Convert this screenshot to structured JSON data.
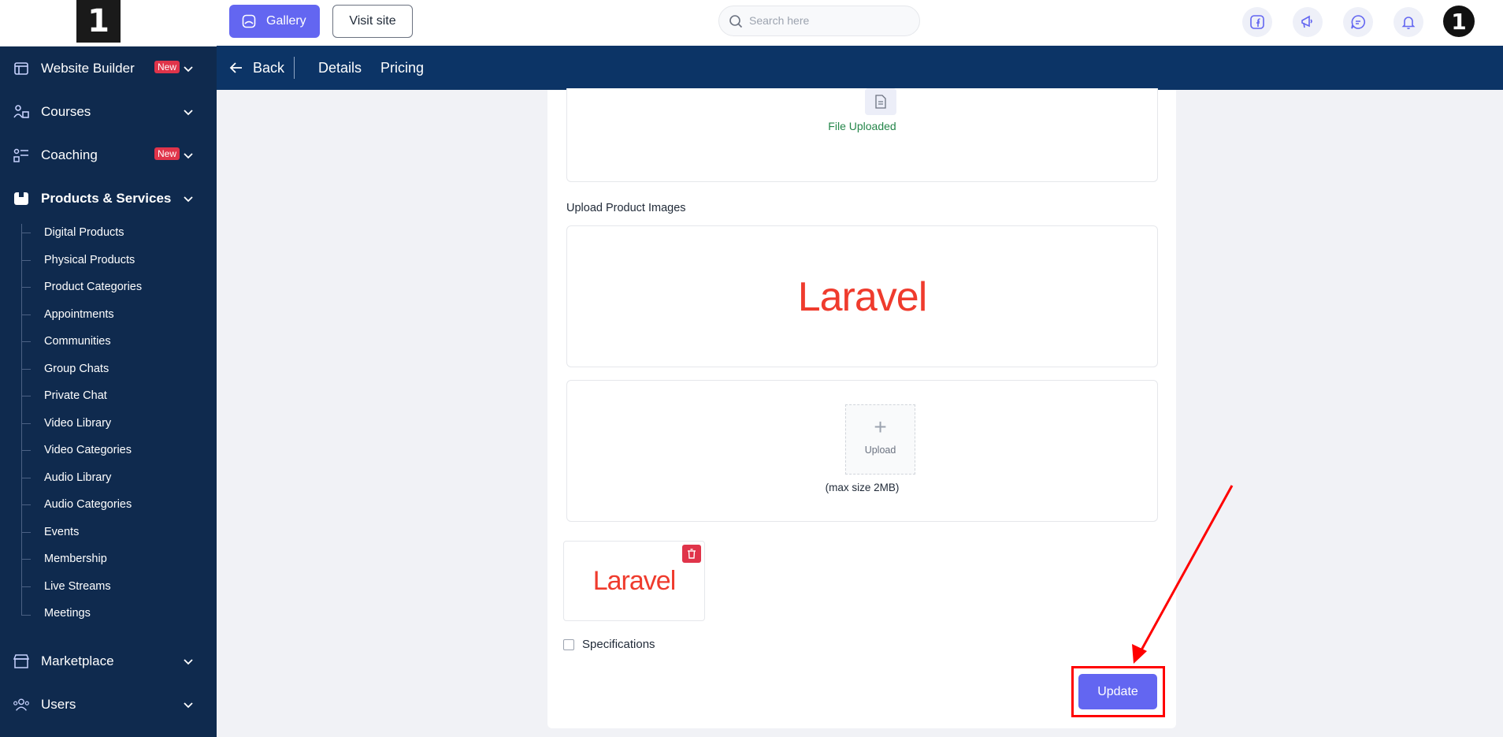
{
  "topbar": {
    "gallery_label": "Gallery",
    "visit_label": "Visit site",
    "search_placeholder": "Search here"
  },
  "sidebar": {
    "logo_text": "1",
    "items": [
      {
        "label": "Website Builder",
        "badge": "New"
      },
      {
        "label": "Courses"
      },
      {
        "label": "Coaching",
        "badge": "New"
      },
      {
        "label": "Products & Services"
      },
      {
        "label": "Marketplace"
      },
      {
        "label": "Users"
      }
    ],
    "sub_items": [
      "Digital Products",
      "Physical Products",
      "Product Categories",
      "Appointments",
      "Communities",
      "Group Chats",
      "Private Chat",
      "Video Library",
      "Video Categories",
      "Audio Library",
      "Audio Categories",
      "Events",
      "Membership",
      "Live Streams",
      "Meetings"
    ]
  },
  "subheader": {
    "back_label": "Back",
    "tabs": [
      "Details",
      "Pricing"
    ]
  },
  "form": {
    "file_status": "File Uploaded",
    "images_label": "Upload Product Images",
    "image_brand": "Laravel",
    "upload_label": "Upload",
    "upload_plus": "+",
    "max_size": "(max size 2MB)",
    "thumb_brand": "Laravel",
    "specifications_label": "Specifications",
    "update_label": "Update"
  },
  "avatar_text": "1",
  "colors": {
    "accent": "#6366f1",
    "sidebar_bg": "#0f2a4e",
    "subheader_bg": "#0c3466",
    "badge": "#e0344a",
    "laravel": "#ef3b2d",
    "success": "#25864a",
    "annotation": "#ff0000"
  }
}
